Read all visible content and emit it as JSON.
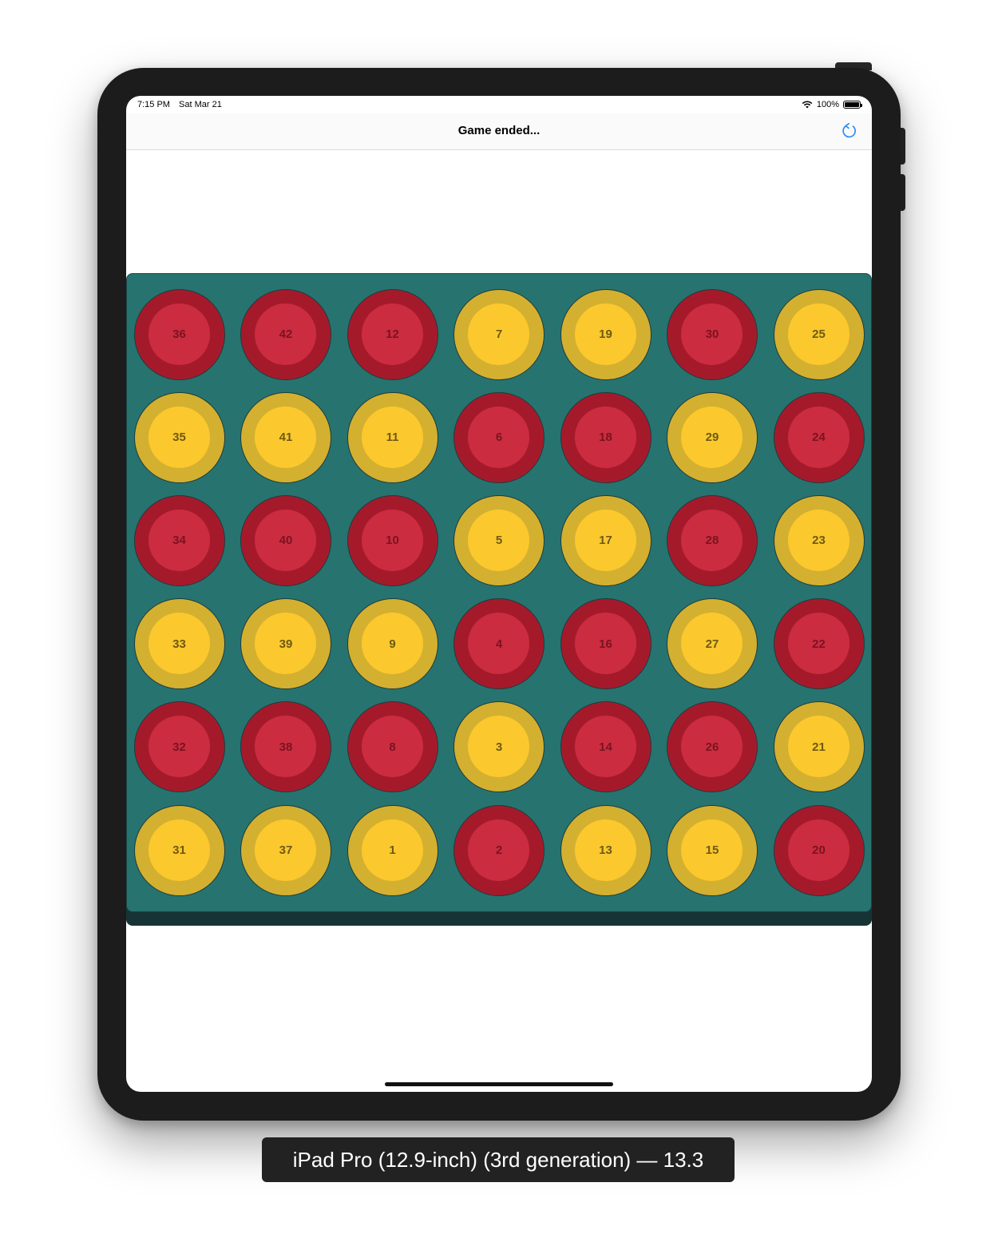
{
  "status_bar": {
    "time": "7:15 PM",
    "date": "Sat Mar 21",
    "battery": "100%",
    "wifi_icon": "wifi-icon",
    "battery_icon": "battery-icon"
  },
  "nav": {
    "title": "Game ended...",
    "refresh_icon": "refresh-icon",
    "accent": "#2f8cf6"
  },
  "board": {
    "columns": 7,
    "rows": 6,
    "colors": {
      "red_outer": "#a51a2b",
      "red_inner": "#cb2c40",
      "yellow_outer": "#d4b030",
      "yellow_inner": "#fbc82e",
      "board": "#277370",
      "board_base": "#163436"
    },
    "cells": [
      [
        {
          "n": "36",
          "c": "red"
        },
        {
          "n": "42",
          "c": "red"
        },
        {
          "n": "12",
          "c": "red"
        },
        {
          "n": "7",
          "c": "yellow"
        },
        {
          "n": "19",
          "c": "yellow"
        },
        {
          "n": "30",
          "c": "red"
        },
        {
          "n": "25",
          "c": "yellow"
        }
      ],
      [
        {
          "n": "35",
          "c": "yellow"
        },
        {
          "n": "41",
          "c": "yellow"
        },
        {
          "n": "11",
          "c": "yellow"
        },
        {
          "n": "6",
          "c": "red"
        },
        {
          "n": "18",
          "c": "red"
        },
        {
          "n": "29",
          "c": "yellow"
        },
        {
          "n": "24",
          "c": "red"
        }
      ],
      [
        {
          "n": "34",
          "c": "red"
        },
        {
          "n": "40",
          "c": "red"
        },
        {
          "n": "10",
          "c": "red"
        },
        {
          "n": "5",
          "c": "yellow"
        },
        {
          "n": "17",
          "c": "yellow"
        },
        {
          "n": "28",
          "c": "red"
        },
        {
          "n": "23",
          "c": "yellow"
        }
      ],
      [
        {
          "n": "33",
          "c": "yellow"
        },
        {
          "n": "39",
          "c": "yellow"
        },
        {
          "n": "9",
          "c": "yellow"
        },
        {
          "n": "4",
          "c": "red"
        },
        {
          "n": "16",
          "c": "red"
        },
        {
          "n": "27",
          "c": "yellow"
        },
        {
          "n": "22",
          "c": "red"
        }
      ],
      [
        {
          "n": "32",
          "c": "red"
        },
        {
          "n": "38",
          "c": "red"
        },
        {
          "n": "8",
          "c": "red"
        },
        {
          "n": "3",
          "c": "yellow"
        },
        {
          "n": "14",
          "c": "red"
        },
        {
          "n": "26",
          "c": "red"
        },
        {
          "n": "21",
          "c": "yellow"
        }
      ],
      [
        {
          "n": "31",
          "c": "yellow"
        },
        {
          "n": "37",
          "c": "yellow"
        },
        {
          "n": "1",
          "c": "yellow"
        },
        {
          "n": "2",
          "c": "red"
        },
        {
          "n": "13",
          "c": "yellow"
        },
        {
          "n": "15",
          "c": "yellow"
        },
        {
          "n": "20",
          "c": "red"
        }
      ]
    ]
  },
  "device_caption": "iPad Pro (12.9-inch) (3rd generation) — 13.3"
}
